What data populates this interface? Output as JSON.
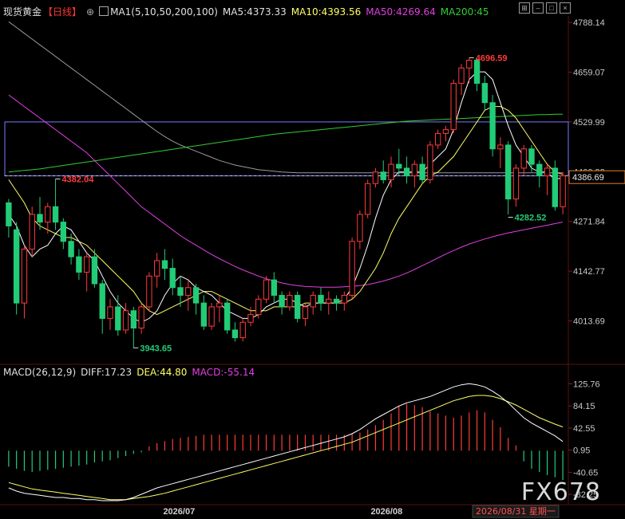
{
  "header": {
    "symbol": "现货黄金",
    "period": "【日线】",
    "ma_label": "MA1(5,10,50,200,100)",
    "ma5": "MA5:4373.33",
    "ma10": "MA10:4393.56",
    "ma50": "MA50:4269.64",
    "ma200": "MA200:45"
  },
  "macd_header": {
    "label": "MACD(26,12,9)",
    "diff": "DIFF:17.23",
    "dea": "DEA:44.80",
    "macd": "MACD:-55.14"
  },
  "icons": [
    "expand-icon",
    "minimize-icon",
    "restore-icon",
    "close-icon"
  ],
  "current_price": "4386.69",
  "watermark": "FX678",
  "footer_date": "2026/08/31 星期一",
  "colors": {
    "up": "#ff3b3b",
    "down": "#22cc77",
    "ma5": "#ffffff",
    "ma10": "#ffff66",
    "ma50": "#e040e0",
    "ma200": "#33cc33",
    "ma100": "#9a9a9a",
    "rect": "#7a7aff"
  },
  "chart_data": [
    {
      "type": "candlestick",
      "title": "现货黄金【日线】",
      "y_ticks": [
        4788.14,
        4659.07,
        4529.99,
        4400.92,
        4271.84,
        4142.77,
        4013.69
      ],
      "ylim": [
        3905,
        4805
      ],
      "x_ticks": [
        "2026/07",
        "2026/08"
      ],
      "annotations": [
        {
          "text": "4382.04",
          "value": 4382.04
        },
        {
          "text": "4696.59",
          "value": 4696.59
        },
        {
          "text": "3943.65",
          "value": 3943.65
        },
        {
          "text": "4282.52",
          "value": 4282.52
        }
      ],
      "rect_level": {
        "top": 4530,
        "bottom": 4390
      },
      "dashed_level": 4390,
      "candles": [
        [
          4320,
          4330,
          4230,
          4260
        ],
        [
          4250,
          4270,
          4030,
          4060
        ],
        [
          4060,
          4210,
          4020,
          4200
        ],
        [
          4200,
          4310,
          4180,
          4290
        ],
        [
          4290,
          4335,
          4250,
          4270
        ],
        [
          4270,
          4320,
          4240,
          4310
        ],
        [
          4310,
          4382,
          4250,
          4270
        ],
        [
          4270,
          4280,
          4200,
          4220
        ],
        [
          4220,
          4240,
          4160,
          4180
        ],
        [
          4180,
          4200,
          4120,
          4140
        ],
        [
          4140,
          4190,
          4090,
          4180
        ],
        [
          4180,
          4200,
          4100,
          4110
        ],
        [
          4110,
          4120,
          3980,
          4020
        ],
        [
          4020,
          4070,
          3990,
          4050
        ],
        [
          4050,
          4080,
          3975,
          3990
        ],
        [
          3990,
          4060,
          3980,
          4040
        ],
        [
          4040,
          4050,
          3943,
          3995
        ],
        [
          3995,
          4060,
          3980,
          4050
        ],
        [
          4050,
          4140,
          4040,
          4130
        ],
        [
          4130,
          4190,
          4100,
          4170
        ],
        [
          4170,
          4200,
          4120,
          4150
        ],
        [
          4150,
          4175,
          4080,
          4100
        ],
        [
          4100,
          4130,
          4050,
          4080
        ],
        [
          4080,
          4120,
          4040,
          4100
        ],
        [
          4100,
          4110,
          4030,
          4060
        ],
        [
          4060,
          4080,
          3990,
          4000
        ],
        [
          4000,
          4060,
          3990,
          4050
        ],
        [
          4050,
          4080,
          4010,
          4060
        ],
        [
          4060,
          4070,
          3980,
          3990
        ],
        [
          3990,
          4010,
          3960,
          3970
        ],
        [
          3970,
          4020,
          3960,
          4010
        ],
        [
          4010,
          4050,
          4000,
          4030
        ],
        [
          4030,
          4080,
          4020,
          4070
        ],
        [
          4070,
          4130,
          4060,
          4120
        ],
        [
          4120,
          4140,
          4060,
          4080
        ],
        [
          4080,
          4090,
          4030,
          4050
        ],
        [
          4050,
          4090,
          4040,
          4080
        ],
        [
          4080,
          4090,
          4010,
          4020
        ],
        [
          4020,
          4060,
          4000,
          4050
        ],
        [
          4050,
          4090,
          4030,
          4080
        ],
        [
          4080,
          4100,
          4040,
          4060
        ],
        [
          4060,
          4090,
          4030,
          4070
        ],
        [
          4070,
          4080,
          4040,
          4060
        ],
        [
          4060,
          4090,
          4040,
          4080
        ],
        [
          4080,
          4230,
          4070,
          4220
        ],
        [
          4220,
          4300,
          4200,
          4290
        ],
        [
          4290,
          4380,
          4280,
          4370
        ],
        [
          4370,
          4410,
          4360,
          4400
        ],
        [
          4400,
          4430,
          4370,
          4380
        ],
        [
          4380,
          4440,
          4360,
          4420
        ],
        [
          4420,
          4460,
          4390,
          4410
        ],
        [
          4410,
          4440,
          4370,
          4390
        ],
        [
          4390,
          4430,
          4360,
          4420
        ],
        [
          4420,
          4440,
          4370,
          4380
        ],
        [
          4380,
          4480,
          4370,
          4470
        ],
        [
          4470,
          4510,
          4460,
          4500
        ],
        [
          4500,
          4520,
          4480,
          4510
        ],
        [
          4510,
          4640,
          4500,
          4630
        ],
        [
          4630,
          4680,
          4600,
          4670
        ],
        [
          4670,
          4696,
          4630,
          4690
        ],
        [
          4690,
          4695,
          4610,
          4630
        ],
        [
          4630,
          4650,
          4560,
          4580
        ],
        [
          4580,
          4600,
          4440,
          4460
        ],
        [
          4460,
          4490,
          4410,
          4470
        ],
        [
          4470,
          4480,
          4290,
          4330
        ],
        [
          4330,
          4420,
          4310,
          4410
        ],
        [
          4410,
          4470,
          4390,
          4460
        ],
        [
          4460,
          4470,
          4400,
          4420
        ],
        [
          4420,
          4430,
          4360,
          4390
        ],
        [
          4390,
          4420,
          4340,
          4410
        ],
        [
          4410,
          4430,
          4300,
          4310
        ],
        [
          4310,
          4400,
          4290,
          4390
        ]
      ],
      "ma5": [
        4290,
        4260,
        4210,
        4180,
        4200,
        4210,
        4240,
        4260,
        4250,
        4220,
        4190,
        4170,
        4130,
        4090,
        4060,
        4040,
        4020,
        4010,
        4020,
        4040,
        4080,
        4110,
        4130,
        4120,
        4100,
        4090,
        4080,
        4060,
        4040,
        4030,
        4020,
        4020,
        4030,
        4050,
        4060,
        4070,
        4070,
        4060,
        4050,
        4060,
        4060,
        4060,
        4060,
        4070,
        4100,
        4150,
        4210,
        4280,
        4340,
        4380,
        4400,
        4400,
        4400,
        4400,
        4420,
        4440,
        4460,
        4510,
        4580,
        4640,
        4660,
        4660,
        4640,
        4580,
        4520,
        4470,
        4440,
        4410,
        4400,
        4400,
        4380,
        4386
      ],
      "ma10": [
        4380,
        4350,
        4320,
        4280,
        4260,
        4250,
        4240,
        4230,
        4230,
        4220,
        4210,
        4190,
        4170,
        4150,
        4130,
        4110,
        4090,
        4060,
        4040,
        4030,
        4040,
        4050,
        4060,
        4070,
        4080,
        4090,
        4090,
        4080,
        4070,
        4060,
        4050,
        4040,
        4040,
        4040,
        4050,
        4050,
        4050,
        4050,
        4060,
        4060,
        4060,
        4060,
        4060,
        4060,
        4070,
        4090,
        4120,
        4150,
        4190,
        4240,
        4280,
        4310,
        4340,
        4370,
        4390,
        4400,
        4420,
        4440,
        4470,
        4500,
        4530,
        4560,
        4570,
        4570,
        4560,
        4540,
        4510,
        4480,
        4450,
        4420,
        4400,
        4394
      ],
      "ma50": [
        4600,
        4585,
        4570,
        4555,
        4540,
        4525,
        4510,
        4495,
        4480,
        4465,
        4450,
        4430,
        4410,
        4390,
        4370,
        4350,
        4330,
        4310,
        4295,
        4280,
        4265,
        4250,
        4235,
        4222,
        4210,
        4198,
        4186,
        4175,
        4165,
        4155,
        4146,
        4138,
        4130,
        4123,
        4117,
        4112,
        4108,
        4105,
        4103,
        4102,
        4101,
        4101,
        4101,
        4102,
        4103,
        4105,
        4108,
        4112,
        4117,
        4123,
        4130,
        4138,
        4147,
        4157,
        4167,
        4177,
        4187,
        4196,
        4205,
        4213,
        4220,
        4226,
        4232,
        4237,
        4242,
        4246,
        4250,
        4254,
        4258,
        4262,
        4266,
        4270
      ],
      "ma100": [
        4790,
        4775,
        4760,
        4745,
        4730,
        4715,
        4700,
        4685,
        4670,
        4655,
        4640,
        4625,
        4610,
        4595,
        4580,
        4565,
        4550,
        4535,
        4520,
        4505,
        4492,
        4480,
        4470,
        4462,
        4454,
        4446,
        4438,
        4430,
        4424,
        4418,
        4414,
        4410,
        4406,
        4404,
        4402,
        4400,
        4399,
        4398,
        4398,
        4398,
        4398,
        4398,
        4398,
        4398,
        4398,
        4398,
        4398,
        4398,
        4398,
        4398,
        4398,
        4398,
        4398,
        4398,
        4398,
        4398,
        4398,
        4398,
        4398,
        4398,
        4398,
        4398,
        4398,
        4398,
        4398,
        4398,
        4398,
        4398,
        4398,
        4398,
        4398,
        4398
      ],
      "ma200": [
        4400,
        4402,
        4404,
        4406,
        4408,
        4411,
        4414,
        4417,
        4420,
        4423,
        4426,
        4429,
        4432,
        4435,
        4438,
        4441,
        4444,
        4447,
        4450,
        4453,
        4456,
        4459,
        4462,
        4465,
        4468,
        4471,
        4474,
        4477,
        4480,
        4483,
        4486,
        4489,
        4492,
        4495,
        4498,
        4500,
        4502,
        4504,
        4506,
        4508,
        4510,
        4512,
        4514,
        4516,
        4518,
        4520,
        4522,
        4524,
        4526,
        4528,
        4530,
        4532,
        4533,
        4534,
        4535,
        4536,
        4537,
        4538,
        4539,
        4540,
        4541,
        4542,
        4543,
        4544,
        4545,
        4546,
        4547,
        4548,
        4549,
        4549,
        4550,
        4550
      ]
    },
    {
      "type": "bar",
      "title": "MACD(26,12,9)",
      "y_ticks": [
        125.76,
        84.15,
        42.55,
        0.95,
        -40.65,
        -82.25
      ],
      "ylim": [
        -100,
        140
      ],
      "macd": [
        -30,
        -34,
        -38,
        -40,
        -38,
        -36,
        -34,
        -32,
        -30,
        -28,
        -26,
        -22,
        -20,
        -18,
        -14,
        -10,
        -6,
        -3,
        8,
        14,
        18,
        22,
        24,
        26,
        28,
        30,
        30,
        30,
        30,
        30,
        30,
        30,
        30,
        30,
        30,
        30,
        30,
        30,
        30,
        30,
        30,
        30,
        30,
        30,
        32,
        34,
        40,
        48,
        58,
        70,
        84,
        88,
        86,
        82,
        74,
        70,
        66,
        62,
        66,
        72,
        76,
        72,
        58,
        44,
        24,
        10,
        -20,
        -34,
        -40,
        -46,
        -50,
        -55.14
      ],
      "diff": [
        -70,
        -76,
        -80,
        -82,
        -84,
        -86,
        -88,
        -88,
        -90,
        -90,
        -92,
        -92,
        -94,
        -94,
        -94,
        -92,
        -88,
        -82,
        -76,
        -70,
        -66,
        -62,
        -58,
        -54,
        -50,
        -46,
        -42,
        -38,
        -34,
        -30,
        -26,
        -22,
        -18,
        -14,
        -10,
        -6,
        -2,
        2,
        6,
        10,
        14,
        18,
        22,
        26,
        32,
        40,
        50,
        60,
        68,
        76,
        84,
        90,
        94,
        98,
        102,
        108,
        114,
        120,
        124,
        126,
        124,
        120,
        112,
        102,
        90,
        76,
        62,
        52,
        44,
        36,
        28,
        17.23
      ],
      "dea": [
        -60,
        -64,
        -68,
        -72,
        -74,
        -76,
        -78,
        -80,
        -82,
        -84,
        -86,
        -88,
        -90,
        -92,
        -92,
        -92,
        -90,
        -88,
        -86,
        -83,
        -80,
        -76,
        -72,
        -68,
        -64,
        -60,
        -56,
        -52,
        -48,
        -44,
        -40,
        -36,
        -32,
        -28,
        -24,
        -20,
        -16,
        -12,
        -8,
        -4,
        0,
        4,
        8,
        12,
        16,
        22,
        28,
        34,
        40,
        46,
        52,
        58,
        64,
        70,
        76,
        82,
        88,
        94,
        98,
        102,
        104,
        104,
        102,
        98,
        92,
        86,
        78,
        70,
        62,
        56,
        50,
        44.8
      ]
    }
  ]
}
